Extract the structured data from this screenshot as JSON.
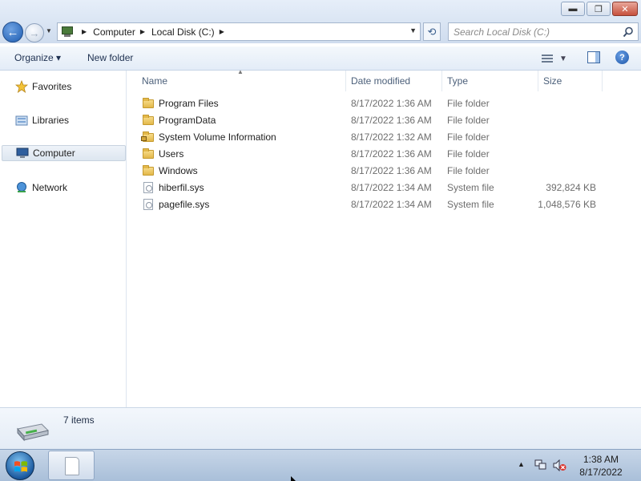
{
  "window": {
    "caption": {
      "minimize": "▬",
      "restore": "❐",
      "close": "✕"
    }
  },
  "address_bar": {
    "back_glyph": "←",
    "forward_glyph": "→",
    "breadcrumbs": [
      "Computer",
      "Local Disk (C:)"
    ],
    "refresh_glyph": "⟲",
    "search_placeholder": "Search Local Disk (C:)"
  },
  "command_bar": {
    "organize_label": "Organize ▾",
    "new_folder_label": "New folder",
    "help_glyph": "?"
  },
  "navigation": {
    "items": [
      {
        "label": "Favorites",
        "icon": "star-icon"
      },
      {
        "label": "Libraries",
        "icon": "library-icon"
      },
      {
        "label": "Computer",
        "icon": "computer-icon",
        "selected": true
      },
      {
        "label": "Network",
        "icon": "network-icon"
      }
    ]
  },
  "file_list": {
    "columns": [
      "Name",
      "Date modified",
      "Type",
      "Size"
    ],
    "rows": [
      {
        "name": "Program Files",
        "date": "8/17/2022 1:36 AM",
        "type": "File folder",
        "size": "",
        "icon": "folder-icon"
      },
      {
        "name": "ProgramData",
        "date": "8/17/2022 1:36 AM",
        "type": "File folder",
        "size": "",
        "icon": "folder-icon"
      },
      {
        "name": "System Volume Information",
        "date": "8/17/2022 1:32 AM",
        "type": "File folder",
        "size": "",
        "icon": "locked-folder-icon"
      },
      {
        "name": "Users",
        "date": "8/17/2022 1:36 AM",
        "type": "File folder",
        "size": "",
        "icon": "folder-icon"
      },
      {
        "name": "Windows",
        "date": "8/17/2022 1:36 AM",
        "type": "File folder",
        "size": "",
        "icon": "folder-icon"
      },
      {
        "name": "hiberfil.sys",
        "date": "8/17/2022 1:34 AM",
        "type": "System file",
        "size": "392,824 KB",
        "icon": "system-file-icon"
      },
      {
        "name": "pagefile.sys",
        "date": "8/17/2022 1:34 AM",
        "type": "System file",
        "size": "1,048,576 KB",
        "icon": "system-file-icon"
      }
    ]
  },
  "details_pane": {
    "item_count": "7 items"
  },
  "taskbar": {
    "tray_arrow": "▲",
    "time": "1:38 AM",
    "date": "8/17/2022"
  }
}
